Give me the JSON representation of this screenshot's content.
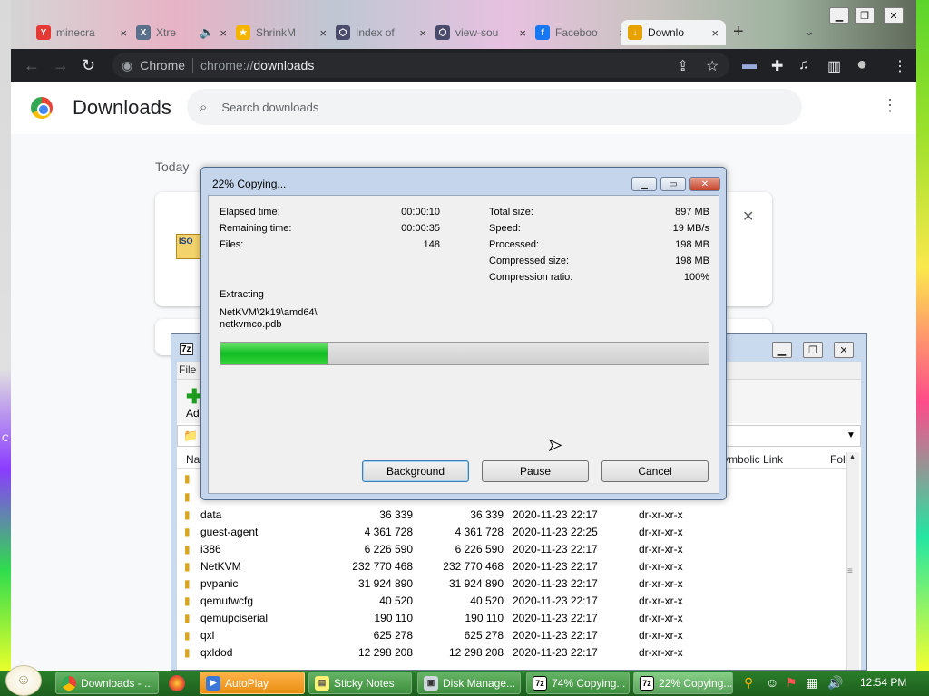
{
  "browser": {
    "tabs": [
      {
        "label": "minecra",
        "icon": "yandex-icon",
        "color": "#e53935",
        "glyph": "Y"
      },
      {
        "label": "Xtre",
        "icon": "xtreme-icon",
        "color": "#5a6f8a",
        "glyph": "X"
      },
      {
        "label": "ShrinkM",
        "icon": "star-icon",
        "color": "#f4b400",
        "glyph": "★"
      },
      {
        "label": "Index of",
        "icon": "server-icon",
        "color": "#4a4a6a",
        "glyph": "⬡"
      },
      {
        "label": "view-sou",
        "icon": "server-icon",
        "color": "#4a4a6a",
        "glyph": "⬡"
      },
      {
        "label": "Faceboo",
        "icon": "facebook-icon",
        "color": "#1877f2",
        "glyph": "f"
      },
      {
        "label": "Downlo",
        "icon": "download-icon",
        "color": "#e8a200",
        "glyph": "↓"
      }
    ],
    "omnibox": {
      "site": "Chrome",
      "url_prefix": "chrome://",
      "url_host": "downloads"
    }
  },
  "downloads": {
    "title": "Downloads",
    "search_placeholder": "Search downloads",
    "section": "Today",
    "file_icon_label": "ISO"
  },
  "file_manager": {
    "menu_file": "File",
    "add_label": "Add",
    "columns": {
      "name": "Name",
      "link": "Symbolic Link",
      "folder": "Fol"
    },
    "rows": [
      {
        "name": "data",
        "size": "36 339",
        "packed": "36 339",
        "modified": "2020-11-23 22:17",
        "mode": "dr-xr-xr-x"
      },
      {
        "name": "guest-agent",
        "size": "4 361 728",
        "packed": "4 361 728",
        "modified": "2020-11-23 22:25",
        "mode": "dr-xr-xr-x"
      },
      {
        "name": "i386",
        "size": "6 226 590",
        "packed": "6 226 590",
        "modified": "2020-11-23 22:17",
        "mode": "dr-xr-xr-x"
      },
      {
        "name": "NetKVM",
        "size": "232 770 468",
        "packed": "232 770 468",
        "modified": "2020-11-23 22:17",
        "mode": "dr-xr-xr-x"
      },
      {
        "name": "pvpanic",
        "size": "31 924 890",
        "packed": "31 924 890",
        "modified": "2020-11-23 22:17",
        "mode": "dr-xr-xr-x"
      },
      {
        "name": "qemufwcfg",
        "size": "40 520",
        "packed": "40 520",
        "modified": "2020-11-23 22:17",
        "mode": "dr-xr-xr-x"
      },
      {
        "name": "qemupciserial",
        "size": "190 110",
        "packed": "190 110",
        "modified": "2020-11-23 22:17",
        "mode": "dr-xr-xr-x"
      },
      {
        "name": "qxl",
        "size": "625 278",
        "packed": "625 278",
        "modified": "2020-11-23 22:17",
        "mode": "dr-xr-xr-x"
      },
      {
        "name": "qxldod",
        "size": "12 298 208",
        "packed": "12 298 208",
        "modified": "2020-11-23 22:17",
        "mode": "dr-xr-xr-x"
      }
    ]
  },
  "copy_dialog": {
    "title": "22% Copying...",
    "left_stats": [
      {
        "label": "Elapsed time:",
        "value": "00:00:10"
      },
      {
        "label": "Remaining time:",
        "value": "00:00:35"
      },
      {
        "label": "Files:",
        "value": "148"
      }
    ],
    "right_stats": [
      {
        "label": "Total size:",
        "value": "897 MB"
      },
      {
        "label": "Speed:",
        "value": "19 MB/s"
      },
      {
        "label": "Processed:",
        "value": "198 MB"
      },
      {
        "label": "Compressed size:",
        "value": "198 MB"
      },
      {
        "label": "Compression ratio:",
        "value": "100%"
      }
    ],
    "operation": "Extracting",
    "current_path": "NetKVM\\2k19\\amd64\\",
    "current_file": "netkvmco.pdb",
    "progress_fraction": 0.22,
    "buttons": {
      "background": "Background",
      "pause": "Pause",
      "cancel": "Cancel"
    }
  },
  "taskbar": {
    "items": [
      {
        "label": "Downloads - ...",
        "icon": "chrome-icon",
        "style": ""
      },
      {
        "label": "AutoPlay",
        "icon": "autoplay-icon",
        "style": "orange"
      },
      {
        "label": "Sticky Notes",
        "icon": "sticky-notes-icon",
        "style": ""
      },
      {
        "label": "Disk Manage...",
        "icon": "disk-icon",
        "style": ""
      },
      {
        "label": "74% Copying...",
        "icon": "7zip-icon",
        "style": ""
      },
      {
        "label": "22% Copying...",
        "icon": "7zip-icon",
        "style": "active"
      }
    ],
    "clock": "12:54 PM"
  }
}
